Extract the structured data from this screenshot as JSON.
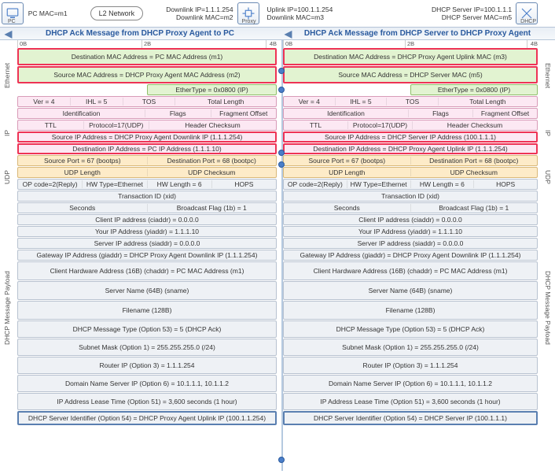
{
  "top": {
    "pc_mac": "PC MAC=m1",
    "l2": "L2 Network",
    "dl_ip": "Downlink IP=1.1.1.254",
    "dl_mac": "Downlink MAC=m2",
    "proxy": "Proxy",
    "ul_ip": "Uplink IP=100.1.1.254",
    "ul_mac": "Downlink MAC=m3",
    "srv_ip": "DHCP Server IP=100.1.1.1",
    "srv_mac": "DHCP Server MAC=m5",
    "dhcp": "DHCP",
    "pc": "PC"
  },
  "titles": {
    "left": "DHCP Ack Message from DHCP Proxy Agent to PC",
    "right": "DHCP Ack Message from DHCP Server to DHCP Proxy Agent"
  },
  "ruler": {
    "b0": "0B",
    "b2": "2B",
    "b4": "4B"
  },
  "sides": {
    "eth": "Ethernet",
    "ip": "IP",
    "udp": "UDP",
    "pl": "DHCP Message Payload"
  },
  "left": {
    "eth_dst": "Destination MAC Address = PC MAC Address (m1)",
    "eth_src": "Source MAC Address = DHCP Proxy Agent MAC Address (m2)",
    "eth_type": "EtherType = 0x0800 (IP)",
    "ip1": {
      "a": "Ver = 4",
      "b": "IHL = 5",
      "c": "TOS",
      "d": "Total Length"
    },
    "ip2": {
      "a": "Identification",
      "b": "Flags",
      "c": "Fragment Offset"
    },
    "ip3": {
      "a": "TTL",
      "b": "Protocol=17(UDP)",
      "c": "Header Checksum"
    },
    "ip_src": "Source IP Address = DHCP Proxy Agent Downlink IP (1.1.1.254)",
    "ip_dst": "Destination IP Address = PC IP Address (1.1.1.10)",
    "udp1": {
      "a": "Source Port = 67 (bootps)",
      "b": "Destination Port = 68 (bootpc)"
    },
    "udp2": {
      "a": "UDP Length",
      "b": "UDP Checksum"
    },
    "p1": {
      "a": "OP code=2(Reply)",
      "b": "HW Type=Ethernet",
      "c": "HW Length = 6",
      "d": "HOPS"
    },
    "p2": "Transaction ID (xid)",
    "p3": {
      "a": "Seconds",
      "b": "Broadcast Flag (1b) = 1"
    },
    "p4": "Client IP address (ciaddr) = 0.0.0.0",
    "p5": "Your IP Address (yiaddr) = 1.1.1.10",
    "p6": "Server IP address (siaddr) = 0.0.0.0",
    "p7": "Gateway IP Address (giaddr) = DHCP Proxy Agent Downlink IP (1.1.1.254)",
    "p8": "Client Hardware Address (16B) (chaddr) = PC MAC Address (m1)",
    "p9": "Server Name (64B) (sname)",
    "p10": "Filename (128B)",
    "p11": "DHCP Message Type (Option 53) = 5 (DHCP Ack)",
    "p12": "Subnet Mask (Option 1) = 255.255.255.0 (/24)",
    "p13": "Router IP (Option 3) = 1.1.1.254",
    "p14": "Domain Name Server IP (Option 6) = 10.1.1.1, 10.1.1.2",
    "p15": "IP Address Lease Time (Option 51) = 3,600 seconds (1 hour)",
    "p16": "DHCP Server Identifier (Option 54) = DHCP Proxy Agent Uplink IP (100.1.1.254)"
  },
  "right": {
    "eth_dst": "Destination MAC Address = DHCP Proxy Agent Uplink MAC (m3)",
    "eth_src": "Source MAC Address = DHCP Server MAC (m5)",
    "eth_type": "EtherType = 0x0800 (IP)",
    "ip1": {
      "a": "Ver = 4",
      "b": "IHL = 5",
      "c": "TOS",
      "d": "Total Length"
    },
    "ip2": {
      "a": "Identification",
      "b": "Flags",
      "c": "Fragment Offset"
    },
    "ip3": {
      "a": "TTL",
      "b": "Protocol=17(UDP)",
      "c": "Header Checksum"
    },
    "ip_src": "Source IP Address = DHCP Server IP Address (100.1.1.1)",
    "ip_dst": "Destination IP Address = DHCP Proxy Agent Uplink IP (1.1.1.254)",
    "udp1": {
      "a": "Source Port = 67 (bootps)",
      "b": "Destination Port = 68 (bootpc)"
    },
    "udp2": {
      "a": "UDP Length",
      "b": "UDP Checksum"
    },
    "p1": {
      "a": "OP code=2(Reply)",
      "b": "HW Type=Ethernet",
      "c": "HW Length = 6",
      "d": "HOPS"
    },
    "p2": "Transaction ID (xid)",
    "p3": {
      "a": "Seconds",
      "b": "Broadcast Flag (1b) = 1"
    },
    "p4": "Client IP address (ciaddr) = 0.0.0.0",
    "p5": "Your IP Address (yiaddr) = 1.1.1.10",
    "p6": "Server IP address (siaddr) = 0.0.0.0",
    "p7": "Gateway IP Address (giaddr) = DHCP Proxy Agent Downlink IP (1.1.1.254)",
    "p8": "Client Hardware Address (16B) (chaddr) = PC MAC Address (m1)",
    "p9": "Server Name (64B) (sname)",
    "p10": "Filename (128B)",
    "p11": "DHCP Message Type (Option 53) = 5 (DHCP Ack)",
    "p12": "Subnet Mask (Option 1) = 255.255.255.0 (/24)",
    "p13": "Router IP (Option 3) = 1.1.1.254",
    "p14": "Domain Name Server IP (Option 6) = 10.1.1.1, 10.1.1.2",
    "p15": "IP Address Lease Time (Option 51) = 3,600 seconds (1 hour)",
    "p16": "DHCP Server Identifier (Option 54) = DHCP Server IP (100.1.1.1)"
  }
}
